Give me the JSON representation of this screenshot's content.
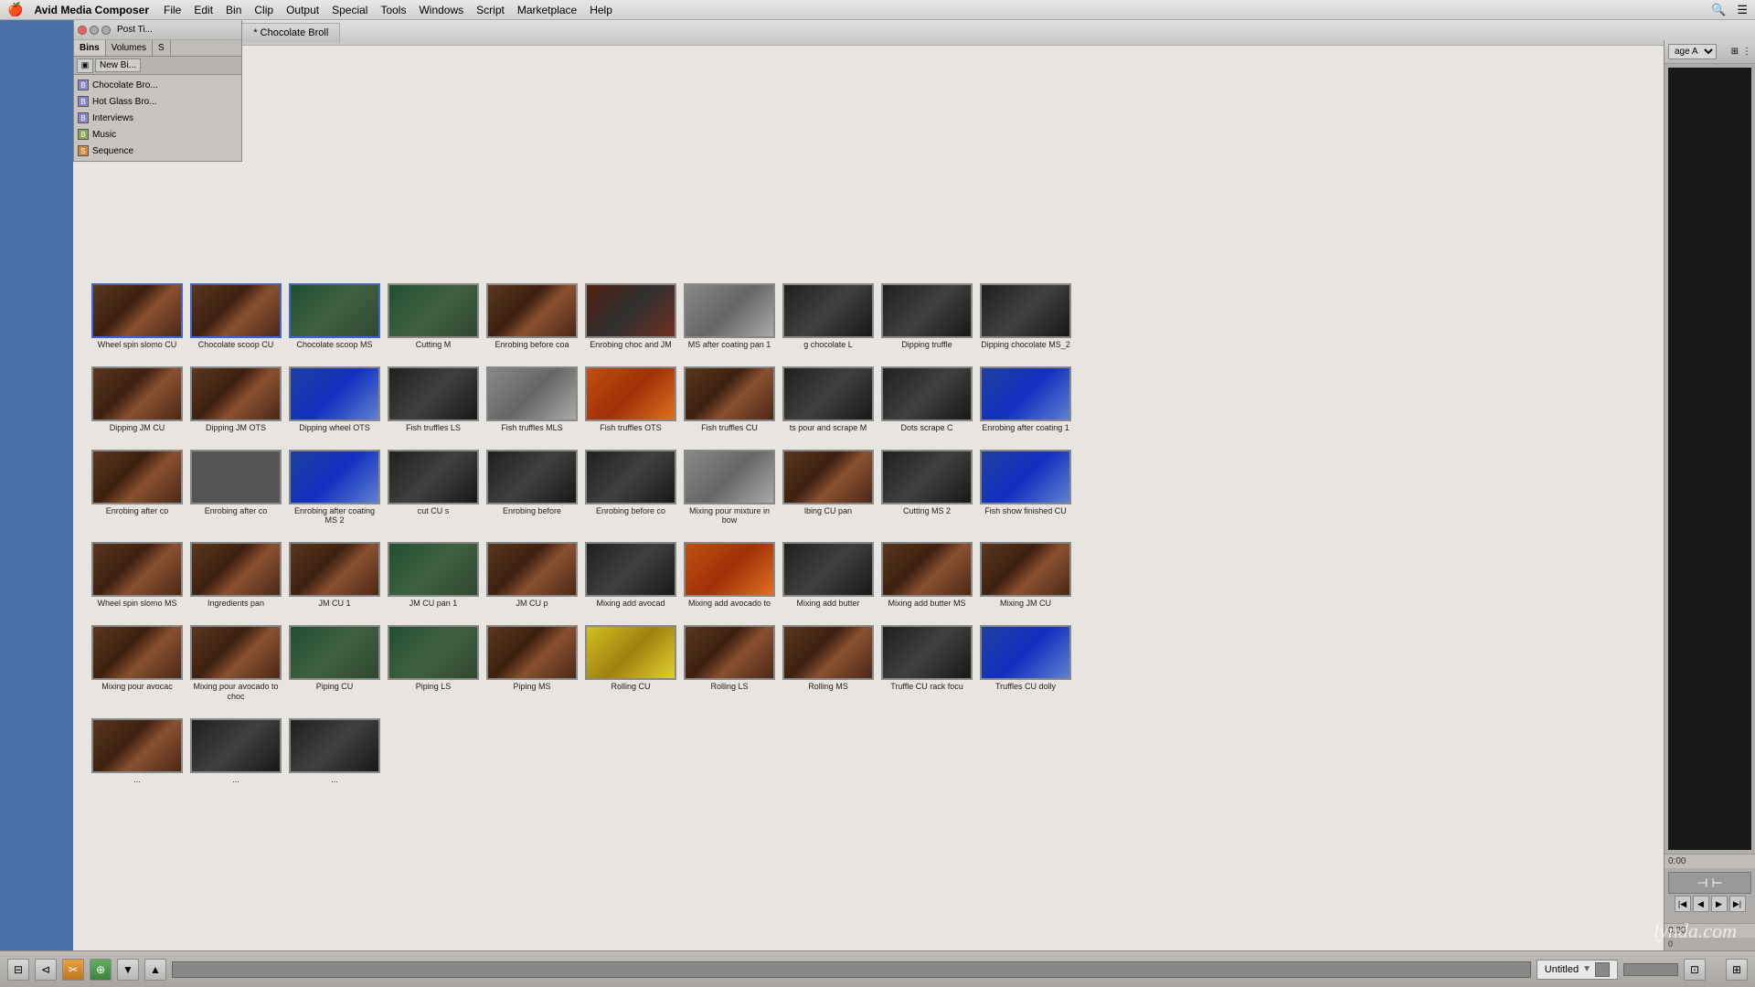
{
  "menubar": {
    "apple": "🍎",
    "app_name": "Avid Media Composer",
    "items": [
      "File",
      "Edit",
      "Bin",
      "Clip",
      "Output",
      "Special",
      "Tools",
      "Windows",
      "Script",
      "Marketplace",
      "Help"
    ]
  },
  "window": {
    "title_active": "* Chocolate Broll",
    "title_inactive": "* Chocolate Broll",
    "tabs": [
      {
        "label": "* Chocolate Broll",
        "active": true
      },
      {
        "label": "* Chocolate Broll",
        "active": false
      }
    ]
  },
  "right_panel": {
    "page_label": "age A"
  },
  "small_bin": {
    "title": "Post Ti...",
    "tabs": [
      "Bins",
      "Volumes",
      "S"
    ],
    "active_tab": "Bins",
    "new_btn": "New Bi...",
    "items": [
      {
        "name": "Chocolate Bro...",
        "type": "bin"
      },
      {
        "name": "Hot Glass Bro...",
        "type": "bin"
      },
      {
        "name": "Interviews",
        "type": "bin"
      },
      {
        "name": "Music",
        "type": "mus"
      },
      {
        "name": "Sequence",
        "type": "seq"
      }
    ]
  },
  "clips": [
    {
      "label": "Wheel spin slomo CU",
      "color": "brown"
    },
    {
      "label": "Chocolate scoop CU",
      "color": "brown"
    },
    {
      "label": "Chocolate scoop MS",
      "color": "green"
    },
    {
      "label": "Cutting M",
      "color": "green"
    },
    {
      "label": "Enrobing before coa",
      "color": "brown"
    },
    {
      "label": "Enrobing choc and JM",
      "color": "mixed"
    },
    {
      "label": "MS after coating pan 1",
      "color": "gray"
    },
    {
      "label": "g chocolate L",
      "color": "dark"
    },
    {
      "label": "Dipping truffle",
      "color": "dark"
    },
    {
      "label": "Dipping chocolate MS_2",
      "color": "dark"
    },
    {
      "label": "Dipping JM CU",
      "color": "brown"
    },
    {
      "label": "Dipping JM OTS",
      "color": "brown"
    },
    {
      "label": "Dipping wheel OTS",
      "color": "blue"
    },
    {
      "label": "Fish truffles LS",
      "color": "dark"
    },
    {
      "label": "Fish truffles MLS",
      "color": "gray"
    },
    {
      "label": "Fish truffles OTS",
      "color": "orange"
    },
    {
      "label": "Fish truffles CU",
      "color": "brown"
    },
    {
      "label": "ts pour and scrape M",
      "color": "dark"
    },
    {
      "label": "Dots scrape C",
      "color": "dark"
    },
    {
      "label": "Enrobing after coating 1",
      "color": "blue"
    },
    {
      "label": "Enrobing after co",
      "color": "brown"
    },
    {
      "label": "Enrobing after co",
      "color": "purple"
    },
    {
      "label": "Enrobing after coating MS 2",
      "color": "blue"
    },
    {
      "label": "cut CU s",
      "color": "dark"
    },
    {
      "label": "Enrobing before",
      "color": "dark"
    },
    {
      "label": "Enrobing before co",
      "color": "dark"
    },
    {
      "label": "Mixing pour mixture in bow",
      "color": "gray"
    },
    {
      "label": "lbing CU pan",
      "color": "brown"
    },
    {
      "label": "Cutting MS 2",
      "color": "dark"
    },
    {
      "label": "Fish show finished CU",
      "color": "blue"
    },
    {
      "label": "Wheel spin slomo MS",
      "color": "brown"
    },
    {
      "label": "Ingredients pan",
      "color": "brown"
    },
    {
      "label": "JM CU 1",
      "color": "brown"
    },
    {
      "label": "JM CU pan 1",
      "color": "green"
    },
    {
      "label": "JM CU p",
      "color": "brown"
    },
    {
      "label": "Mixing add avocad",
      "color": "dark"
    },
    {
      "label": "Mixing add avocado to",
      "color": "orange"
    },
    {
      "label": "Mixing add butter",
      "color": "dark"
    },
    {
      "label": "Mixing add butter MS",
      "color": "brown"
    },
    {
      "label": "Mixing JM CU",
      "color": "brown"
    },
    {
      "label": "Mixing pour avocac",
      "color": "brown"
    },
    {
      "label": "Mixing pour avocado to choc",
      "color": "brown"
    },
    {
      "label": "Piping CU",
      "color": "green"
    },
    {
      "label": "Piping LS",
      "color": "green"
    },
    {
      "label": "Piping MS",
      "color": "brown"
    },
    {
      "label": "Rolling CU",
      "color": "yellow"
    },
    {
      "label": "Rolling LS",
      "color": "brown"
    },
    {
      "label": "Rolling MS",
      "color": "brown"
    },
    {
      "label": "Truffle CU rack focu",
      "color": "dark"
    },
    {
      "label": "Truffles CU dolly",
      "color": "blue"
    },
    {
      "label": "...",
      "color": "brown"
    },
    {
      "label": "...",
      "color": "dark"
    },
    {
      "label": "...",
      "color": "dark"
    }
  ],
  "transport": {
    "title": "Untitled",
    "timecode_left": "0:00",
    "timecode_right": "0:00",
    "slider_val": "0"
  },
  "watermark": "lynda.com"
}
